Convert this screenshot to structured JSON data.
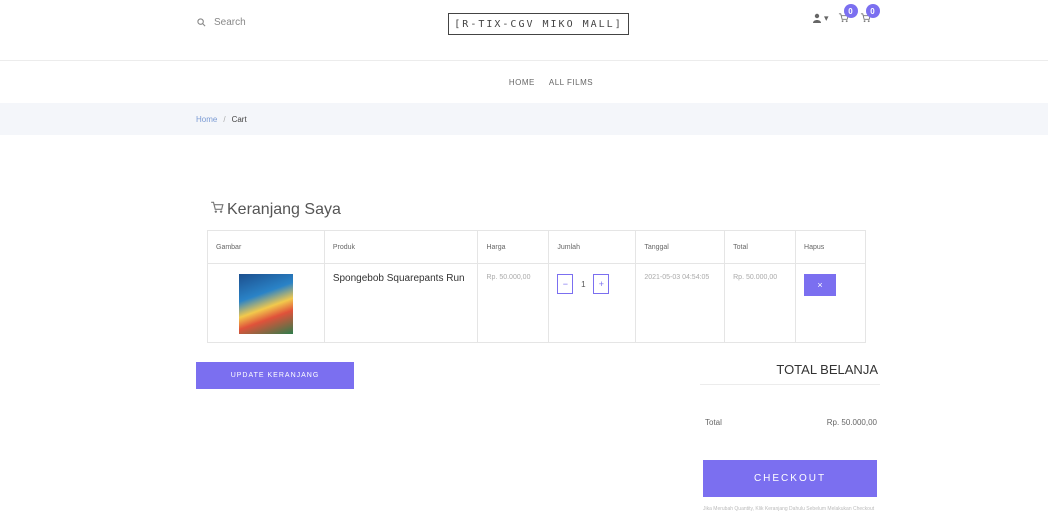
{
  "header": {
    "search_label": "Search",
    "logo_text": "[R-TIX-CGV MIKO MALL]",
    "cart_badge_1": "0",
    "cart_badge_2": "0"
  },
  "nav": {
    "items": [
      "HOME",
      "ALL FILMS"
    ]
  },
  "breadcrumb": {
    "home": "Home",
    "separator": "/",
    "current": "Cart"
  },
  "cart": {
    "title": "Keranjang Saya",
    "columns": [
      "Gambar",
      "Produk",
      "Harga",
      "Jumlah",
      "Tanggal",
      "Total",
      "Hapus"
    ],
    "rows": [
      {
        "product": "Spongebob Squarepants Run",
        "price": "Rp. 50.000,00",
        "quantity": "1",
        "date": "2021-05-03 04:54:05",
        "total": "Rp. 50.000,00",
        "delete_label": "×",
        "qty_minus": "−",
        "qty_plus": "+"
      }
    ],
    "update_button": "UPDATE KERANJANG"
  },
  "summary": {
    "heading": "TOTAL BELANJA",
    "total_label": "Total",
    "total_value": "Rp. 50.000,00",
    "checkout_button": "CHECKOUT",
    "note": "Jika Merubah Quantity, Klik Keranjang Dahulu Sebelum Melakukan Checkout"
  },
  "colors": {
    "accent": "#7b6ff0",
    "breadcrumb_bg": "#f4f6fa"
  },
  "icons": [
    "search-icon",
    "user-icon",
    "cart-icon",
    "cart-title-icon"
  ]
}
